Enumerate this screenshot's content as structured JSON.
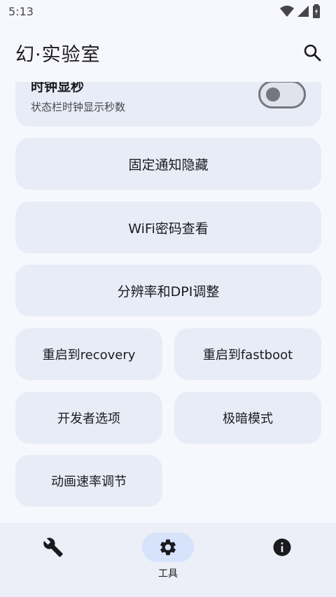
{
  "status_bar": {
    "time": "5:13"
  },
  "app_bar": {
    "title": "幻·实验室"
  },
  "toggle_card": {
    "title": "时钟显秒",
    "subtitle": "状态栏时钟显示秒数",
    "enabled": false
  },
  "buttons": {
    "hide_notification": "固定通知隐藏",
    "wifi_password": "WiFi密码查看",
    "resolution_dpi": "分辨率和DPI调整",
    "reboot_recovery": "重启到recovery",
    "reboot_fastboot": "重启到fastboot",
    "developer_options": "开发者选项",
    "extra_dim": "极暗模式",
    "animation_scale": "动画速率调节"
  },
  "bottom_nav": {
    "items": [
      {
        "icon": "wrench-icon",
        "label": ""
      },
      {
        "icon": "gear-icon",
        "label": "工具",
        "active": true
      },
      {
        "icon": "info-icon",
        "label": ""
      }
    ]
  }
}
